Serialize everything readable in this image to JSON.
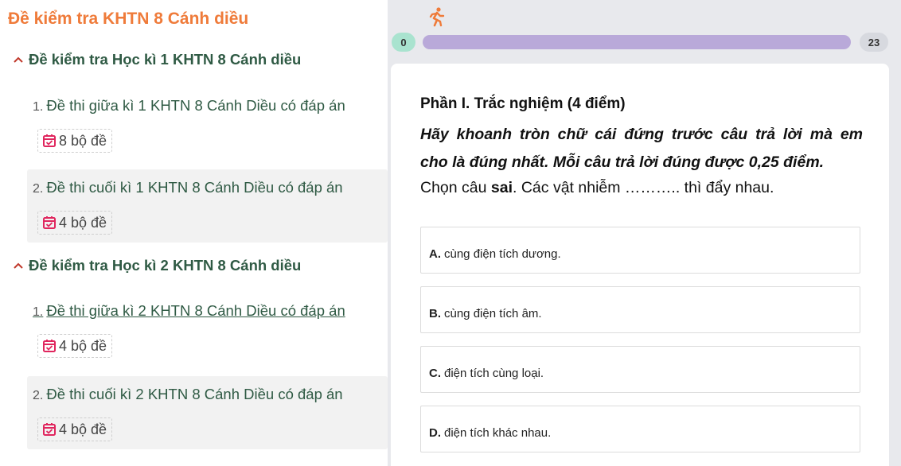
{
  "left": {
    "title": "Đề kiểm tra KHTN 8 Cánh diều",
    "sections": [
      {
        "heading": "Đề kiểm tra Học kì 1 KHTN 8 Cánh diều",
        "items": [
          {
            "num": "1.",
            "title": "Đề thi giữa kì 1 KHTN 8 Cánh Diều có đáp án",
            "badge": "8 bộ đề"
          },
          {
            "num": "2.",
            "title": "Đề thi cuối kì 1 KHTN 8 Cánh Diều có đáp án",
            "badge": "4 bộ đề"
          }
        ]
      },
      {
        "heading": "Đề kiểm tra Học kì 2 KHTN 8 Cánh diều",
        "items": [
          {
            "num": "1.",
            "title": "Đề thi giữa kì 2 KHTN 8 Cánh Diều có đáp án",
            "badge": "4 bộ đề"
          },
          {
            "num": "2.",
            "title": "Đề thi cuối kì 2 KHTN 8 Cánh Diều có đáp án",
            "badge": "4 bộ đề"
          }
        ]
      }
    ]
  },
  "quiz": {
    "score_left": "0",
    "score_right": "23",
    "progress_fraction": 0,
    "section_title": "Phần I. Trắc nghiệm (4 điểm)",
    "instruction_line1": "Hãy khoanh tròn chữ cái đứng trước câu trả lời mà em",
    "instruction_line2": "cho là đúng nhất. Mỗi câu trả lời đúng được 0,25 điểm.",
    "stem_prefix": "Chọn câu ",
    "stem_bold": "sai",
    "stem_suffix": ". Các vật nhiễm ……….. thì đẩy nhau.",
    "options": [
      {
        "letter": "A.",
        "text": "cùng điện tích dương."
      },
      {
        "letter": "B.",
        "text": "cùng điện tích âm."
      },
      {
        "letter": "C.",
        "text": "điện tích cùng loại."
      },
      {
        "letter": "D.",
        "text": "điện tích khác nhau."
      }
    ]
  },
  "colors": {
    "accent_orange": "#ef7b3a",
    "heading_green": "#2f5a44",
    "calendar_pink": "#e0265e",
    "progress_purple": "#b9a9d9",
    "score_green": "#a9e3cf"
  },
  "icons": {
    "caret": "chevron-up-icon",
    "badge": "calendar-check-icon",
    "runner": "running-person-icon"
  }
}
